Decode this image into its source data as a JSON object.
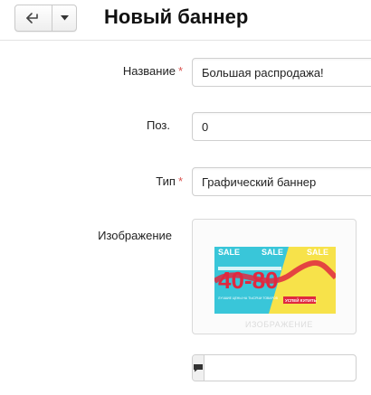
{
  "header": {
    "title": "Новый баннер",
    "back_icon": "arrow-left-icon",
    "caret_icon": "caret-down-icon"
  },
  "form": {
    "name": {
      "label": "Название",
      "required": "*",
      "value": "Большая распродажа!"
    },
    "position": {
      "label": "Поз.",
      "value": "0"
    },
    "type": {
      "label": "Тип",
      "required": "*",
      "value": "Графический баннер"
    },
    "image": {
      "label": "Изображение",
      "banner": {
        "sale_words": [
          "SALE",
          "SALE",
          "SALE"
        ],
        "big_text": "40-80",
        "small_text": "ЛУЧШИЕ ЦЕНЫ НА ТЫСЯЧИ ТОВАРОВ",
        "button_text": "УСПЕЙ КУПИТЬ",
        "colors": {
          "cyan": "#39c6d9",
          "yellow": "#f7e24a",
          "red": "#e0283f",
          "white": "#ffffff"
        }
      },
      "watermark": "ИЗОБРАЖЕНИЕ"
    },
    "comment": {
      "icon": "comment-icon",
      "value": ""
    }
  },
  "colors": {
    "required": "#d9534f",
    "border": "#cfcfcf"
  }
}
